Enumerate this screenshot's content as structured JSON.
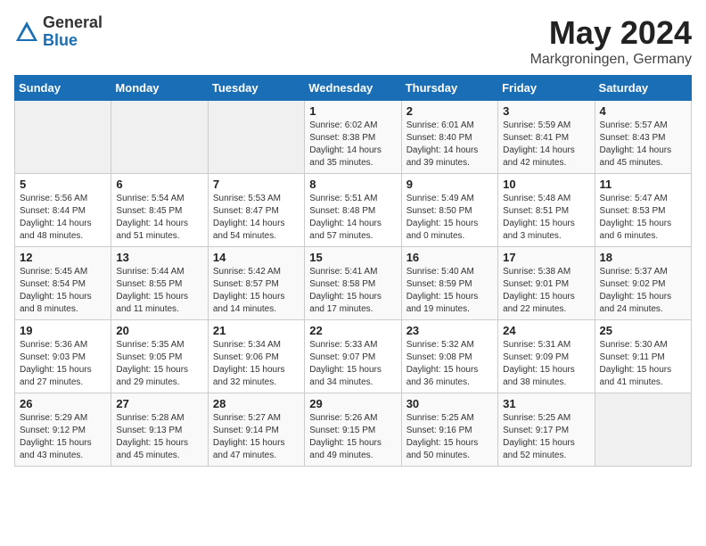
{
  "logo": {
    "general": "General",
    "blue": "Blue"
  },
  "title": "May 2024",
  "subtitle": "Markgroningen, Germany",
  "days_of_week": [
    "Sunday",
    "Monday",
    "Tuesday",
    "Wednesday",
    "Thursday",
    "Friday",
    "Saturday"
  ],
  "weeks": [
    [
      {
        "num": "",
        "info": ""
      },
      {
        "num": "",
        "info": ""
      },
      {
        "num": "",
        "info": ""
      },
      {
        "num": "1",
        "info": "Sunrise: 6:02 AM\nSunset: 8:38 PM\nDaylight: 14 hours\nand 35 minutes."
      },
      {
        "num": "2",
        "info": "Sunrise: 6:01 AM\nSunset: 8:40 PM\nDaylight: 14 hours\nand 39 minutes."
      },
      {
        "num": "3",
        "info": "Sunrise: 5:59 AM\nSunset: 8:41 PM\nDaylight: 14 hours\nand 42 minutes."
      },
      {
        "num": "4",
        "info": "Sunrise: 5:57 AM\nSunset: 8:43 PM\nDaylight: 14 hours\nand 45 minutes."
      }
    ],
    [
      {
        "num": "5",
        "info": "Sunrise: 5:56 AM\nSunset: 8:44 PM\nDaylight: 14 hours\nand 48 minutes."
      },
      {
        "num": "6",
        "info": "Sunrise: 5:54 AM\nSunset: 8:45 PM\nDaylight: 14 hours\nand 51 minutes."
      },
      {
        "num": "7",
        "info": "Sunrise: 5:53 AM\nSunset: 8:47 PM\nDaylight: 14 hours\nand 54 minutes."
      },
      {
        "num": "8",
        "info": "Sunrise: 5:51 AM\nSunset: 8:48 PM\nDaylight: 14 hours\nand 57 minutes."
      },
      {
        "num": "9",
        "info": "Sunrise: 5:49 AM\nSunset: 8:50 PM\nDaylight: 15 hours\nand 0 minutes."
      },
      {
        "num": "10",
        "info": "Sunrise: 5:48 AM\nSunset: 8:51 PM\nDaylight: 15 hours\nand 3 minutes."
      },
      {
        "num": "11",
        "info": "Sunrise: 5:47 AM\nSunset: 8:53 PM\nDaylight: 15 hours\nand 6 minutes."
      }
    ],
    [
      {
        "num": "12",
        "info": "Sunrise: 5:45 AM\nSunset: 8:54 PM\nDaylight: 15 hours\nand 8 minutes."
      },
      {
        "num": "13",
        "info": "Sunrise: 5:44 AM\nSunset: 8:55 PM\nDaylight: 15 hours\nand 11 minutes."
      },
      {
        "num": "14",
        "info": "Sunrise: 5:42 AM\nSunset: 8:57 PM\nDaylight: 15 hours\nand 14 minutes."
      },
      {
        "num": "15",
        "info": "Sunrise: 5:41 AM\nSunset: 8:58 PM\nDaylight: 15 hours\nand 17 minutes."
      },
      {
        "num": "16",
        "info": "Sunrise: 5:40 AM\nSunset: 8:59 PM\nDaylight: 15 hours\nand 19 minutes."
      },
      {
        "num": "17",
        "info": "Sunrise: 5:38 AM\nSunset: 9:01 PM\nDaylight: 15 hours\nand 22 minutes."
      },
      {
        "num": "18",
        "info": "Sunrise: 5:37 AM\nSunset: 9:02 PM\nDaylight: 15 hours\nand 24 minutes."
      }
    ],
    [
      {
        "num": "19",
        "info": "Sunrise: 5:36 AM\nSunset: 9:03 PM\nDaylight: 15 hours\nand 27 minutes."
      },
      {
        "num": "20",
        "info": "Sunrise: 5:35 AM\nSunset: 9:05 PM\nDaylight: 15 hours\nand 29 minutes."
      },
      {
        "num": "21",
        "info": "Sunrise: 5:34 AM\nSunset: 9:06 PM\nDaylight: 15 hours\nand 32 minutes."
      },
      {
        "num": "22",
        "info": "Sunrise: 5:33 AM\nSunset: 9:07 PM\nDaylight: 15 hours\nand 34 minutes."
      },
      {
        "num": "23",
        "info": "Sunrise: 5:32 AM\nSunset: 9:08 PM\nDaylight: 15 hours\nand 36 minutes."
      },
      {
        "num": "24",
        "info": "Sunrise: 5:31 AM\nSunset: 9:09 PM\nDaylight: 15 hours\nand 38 minutes."
      },
      {
        "num": "25",
        "info": "Sunrise: 5:30 AM\nSunset: 9:11 PM\nDaylight: 15 hours\nand 41 minutes."
      }
    ],
    [
      {
        "num": "26",
        "info": "Sunrise: 5:29 AM\nSunset: 9:12 PM\nDaylight: 15 hours\nand 43 minutes."
      },
      {
        "num": "27",
        "info": "Sunrise: 5:28 AM\nSunset: 9:13 PM\nDaylight: 15 hours\nand 45 minutes."
      },
      {
        "num": "28",
        "info": "Sunrise: 5:27 AM\nSunset: 9:14 PM\nDaylight: 15 hours\nand 47 minutes."
      },
      {
        "num": "29",
        "info": "Sunrise: 5:26 AM\nSunset: 9:15 PM\nDaylight: 15 hours\nand 49 minutes."
      },
      {
        "num": "30",
        "info": "Sunrise: 5:25 AM\nSunset: 9:16 PM\nDaylight: 15 hours\nand 50 minutes."
      },
      {
        "num": "31",
        "info": "Sunrise: 5:25 AM\nSunset: 9:17 PM\nDaylight: 15 hours\nand 52 minutes."
      },
      {
        "num": "",
        "info": ""
      }
    ]
  ]
}
